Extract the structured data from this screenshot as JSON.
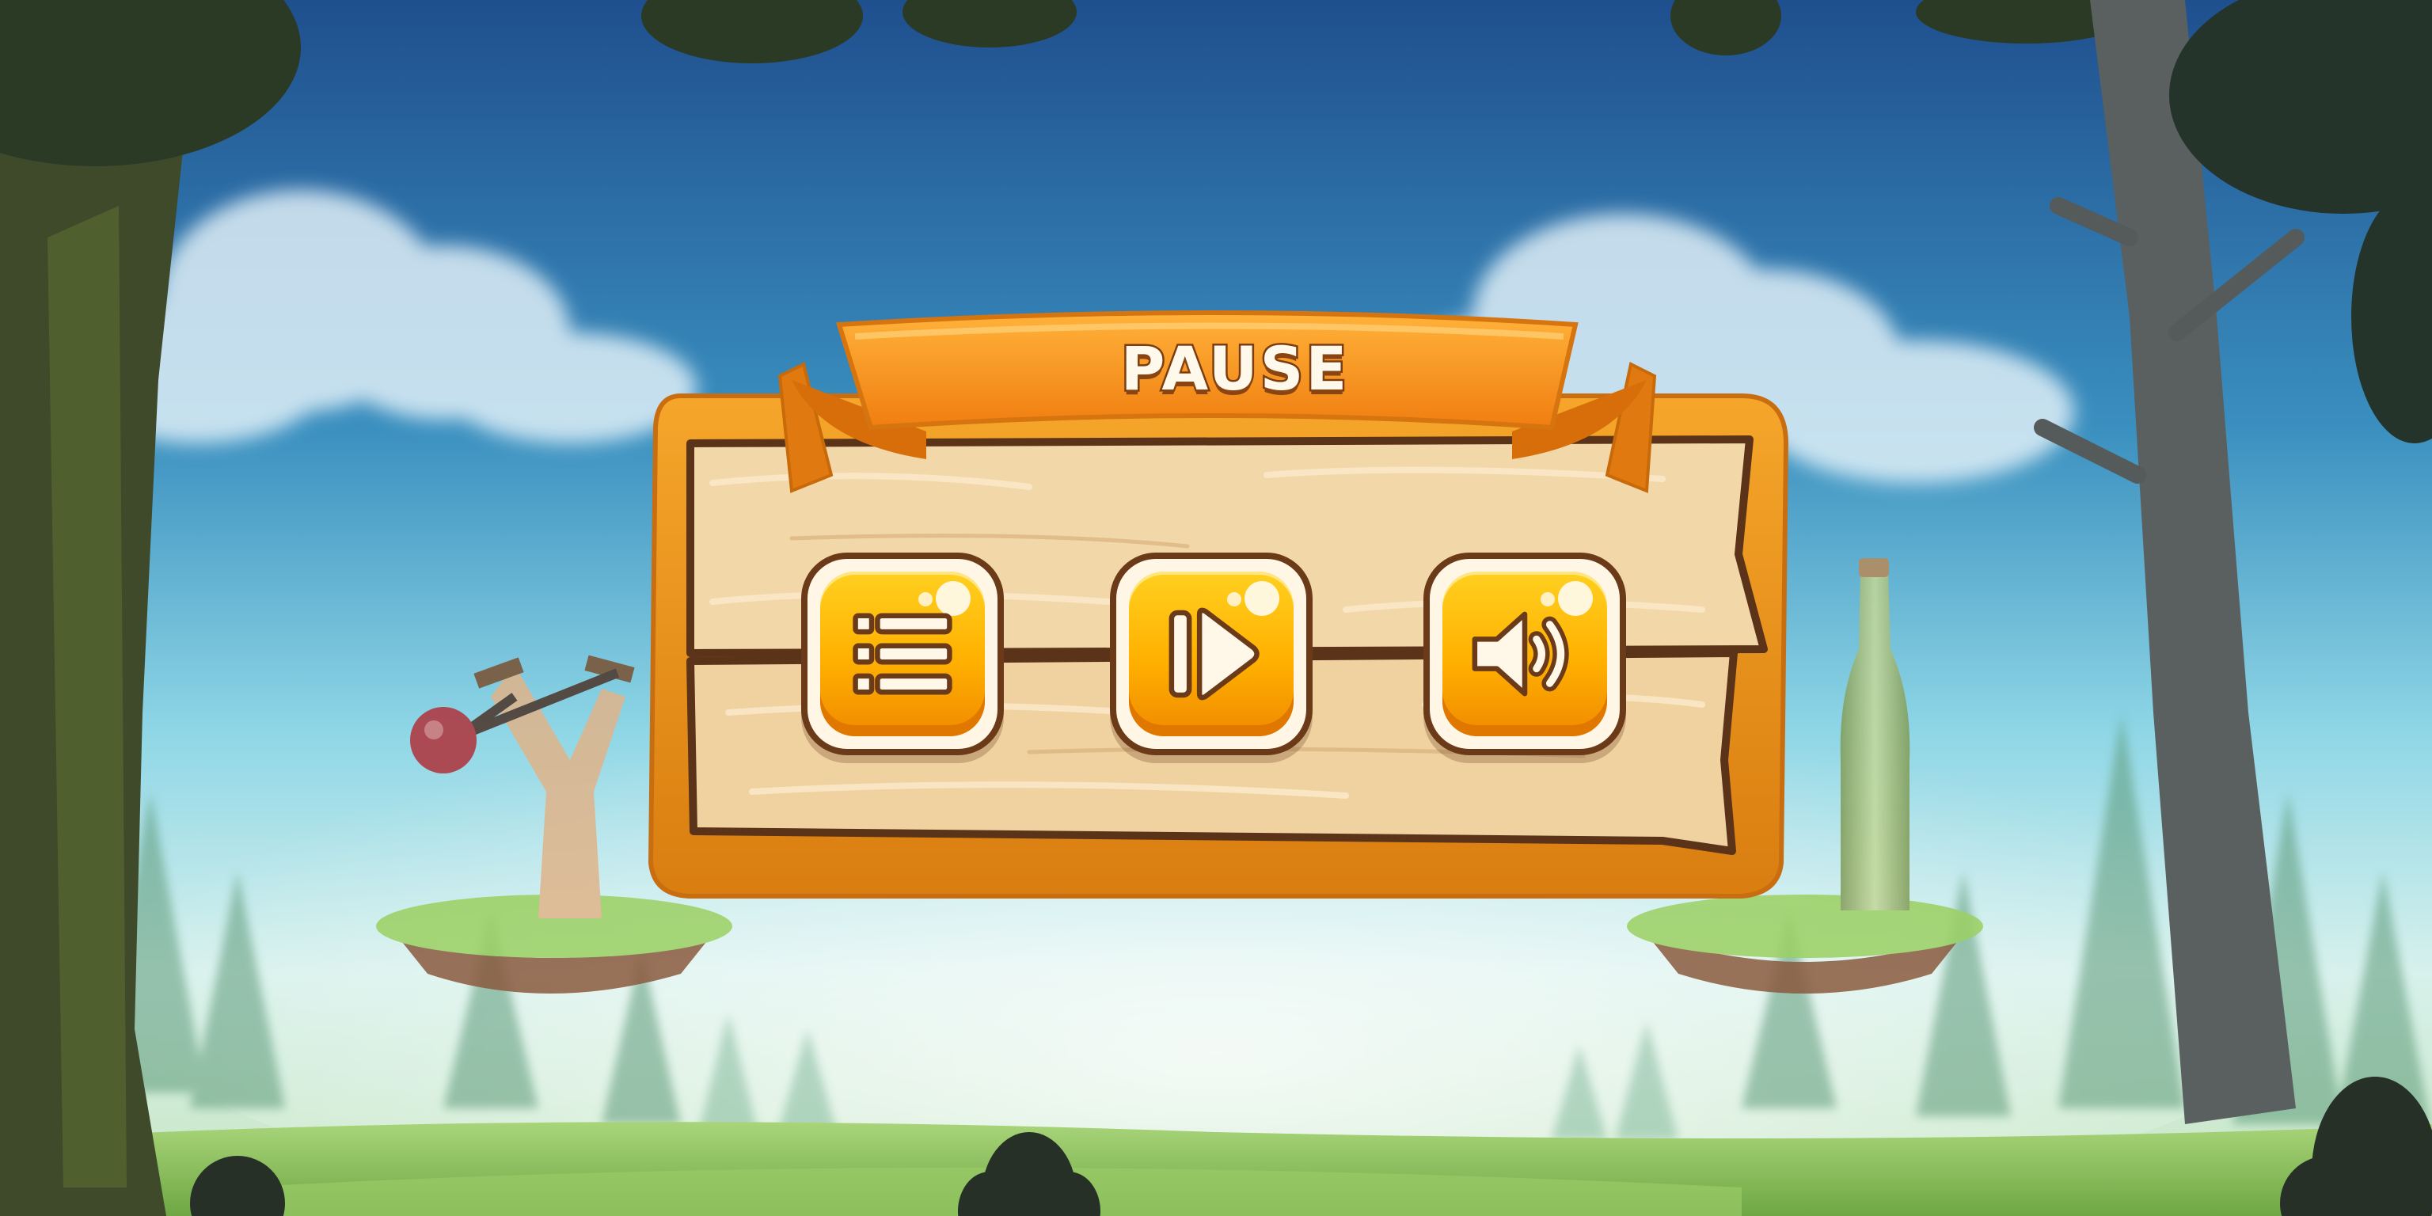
{
  "pause_panel": {
    "title": "PAUSE",
    "buttons": [
      {
        "name": "menu",
        "icon": "menu-list-icon"
      },
      {
        "name": "resume",
        "icon": "play-icon"
      },
      {
        "name": "sound",
        "icon": "speaker-icon"
      }
    ]
  },
  "colors": {
    "banner": "#f7971e",
    "panel_frame": "#e8921c",
    "wood": "#f1d4a4",
    "button_fill": "#ffc10a",
    "outline": "#6b3a18",
    "sky_top": "#2a6aa8",
    "grass": "#8cc25a"
  }
}
